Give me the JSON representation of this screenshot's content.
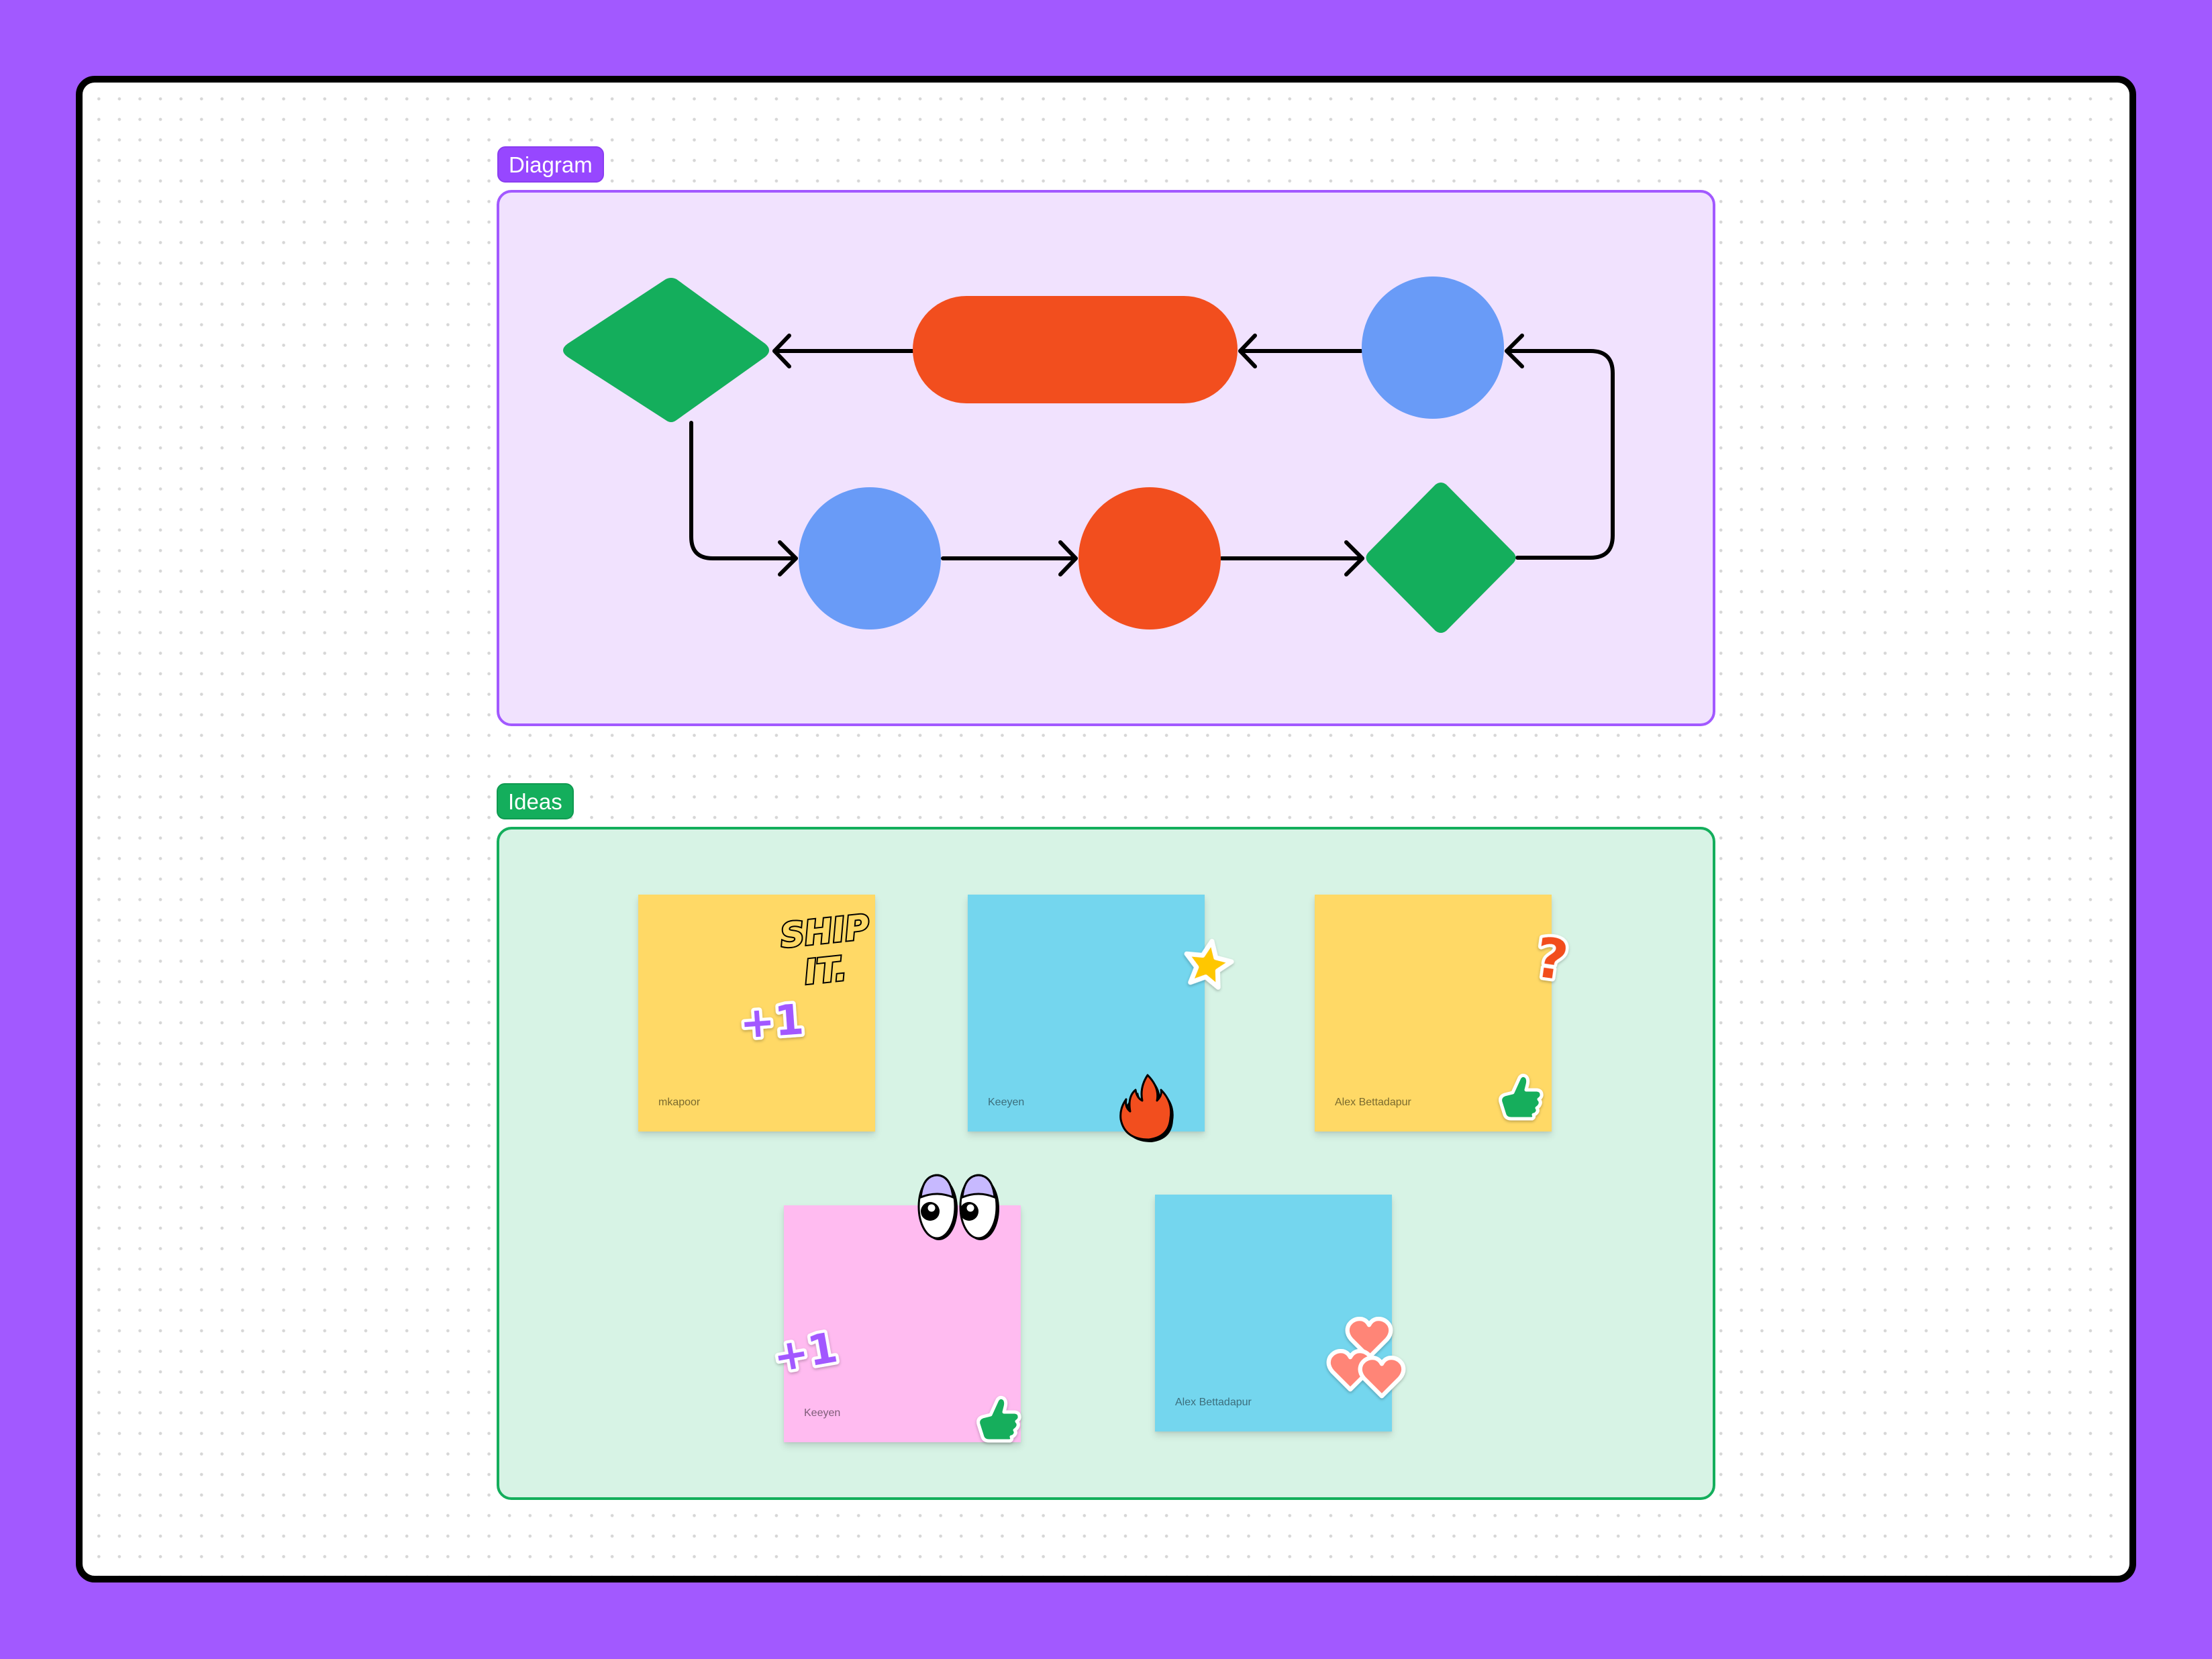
{
  "canvas": {
    "background_color": "#A259FF",
    "frame_border_color": "#000000",
    "board_color": "#FFFFFF"
  },
  "sections": {
    "diagram": {
      "label": "Diagram",
      "color": "#A259FF",
      "fill": "#F1E2FE"
    },
    "ideas": {
      "label": "Ideas",
      "color": "#14AE5C",
      "fill": "#D7F3E5"
    }
  },
  "diagram": {
    "shapes": [
      {
        "id": "decision-top",
        "type": "diamond",
        "color": "#14AE5C"
      },
      {
        "id": "process-pill",
        "type": "pill",
        "color": "#F24E1E"
      },
      {
        "id": "circle-top-right",
        "type": "circle",
        "color": "#699BF7"
      },
      {
        "id": "circle-bottom-left",
        "type": "circle",
        "color": "#699BF7"
      },
      {
        "id": "circle-bottom-middle",
        "type": "circle",
        "color": "#F24E1E"
      },
      {
        "id": "decision-bottom",
        "type": "diamond",
        "color": "#14AE5C"
      }
    ],
    "connectors": [
      {
        "from": "circle-top-right",
        "to": "process-pill"
      },
      {
        "from": "process-pill",
        "to": "decision-top"
      },
      {
        "from": "decision-top",
        "to": "circle-bottom-left"
      },
      {
        "from": "circle-bottom-left",
        "to": "circle-bottom-middle"
      },
      {
        "from": "circle-bottom-middle",
        "to": "decision-bottom"
      },
      {
        "from": "decision-bottom",
        "to": "circle-top-right"
      }
    ],
    "connector_color": "#000000"
  },
  "ideas": {
    "stickies": [
      {
        "author": "mkapoor",
        "color": "yellow",
        "stickers": [
          "ship-it",
          "plus-one"
        ]
      },
      {
        "author": "Keeyen",
        "color": "blue",
        "stickers": [
          "star",
          "fire"
        ]
      },
      {
        "author": "Alex Bettadapur",
        "color": "yellow",
        "stickers": [
          "question-mark",
          "thumbs-up"
        ]
      },
      {
        "author": "Keeyen",
        "color": "pink",
        "stickers": [
          "eyes",
          "plus-one",
          "thumbs-up"
        ]
      },
      {
        "author": "Alex Bettadapur",
        "color": "blue",
        "stickers": [
          "hearts"
        ]
      }
    ],
    "sticker_text": {
      "ship_it_line1": "SHIP",
      "ship_it_line2": "IT.",
      "plus_one": "+1",
      "question": "?"
    }
  }
}
